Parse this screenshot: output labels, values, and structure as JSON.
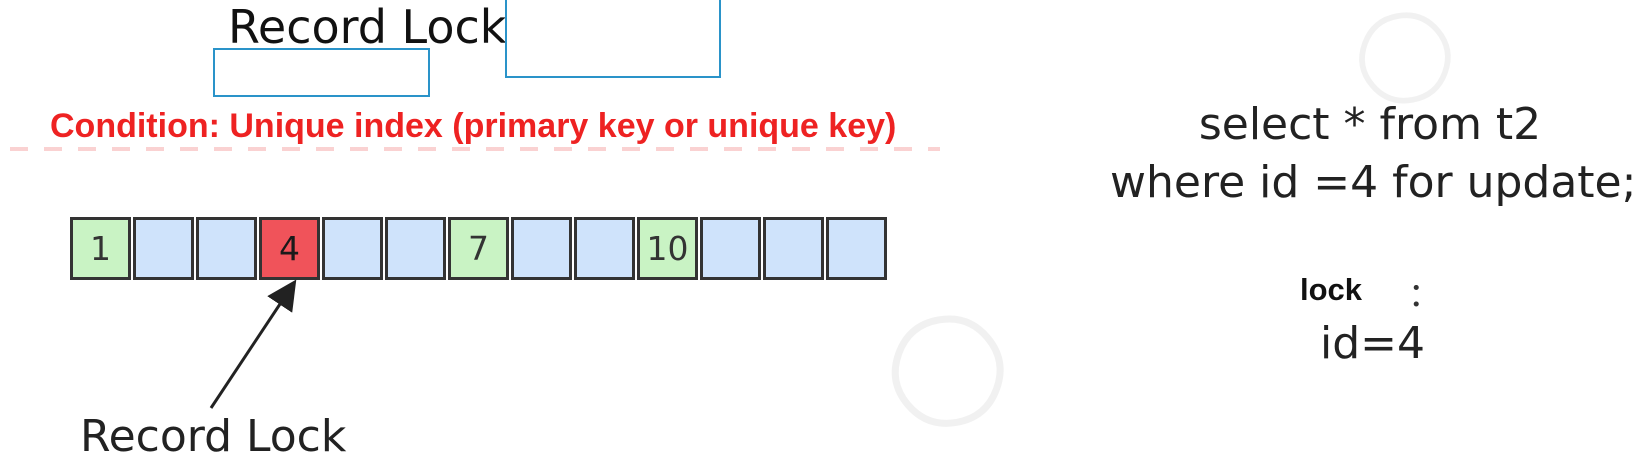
{
  "title": "Record Lock",
  "condition": "Condition: Unique index (primary key or unique key)",
  "cells": [
    {
      "label": "1",
      "state": "green"
    },
    {
      "label": "",
      "state": "blue"
    },
    {
      "label": "",
      "state": "blue"
    },
    {
      "label": "4",
      "state": "red"
    },
    {
      "label": "",
      "state": "blue"
    },
    {
      "label": "",
      "state": "blue"
    },
    {
      "label": "7",
      "state": "green"
    },
    {
      "label": "",
      "state": "blue"
    },
    {
      "label": "",
      "state": "blue"
    },
    {
      "label": "10",
      "state": "green"
    },
    {
      "label": "",
      "state": "blue"
    },
    {
      "label": "",
      "state": "blue"
    },
    {
      "label": "",
      "state": "blue"
    }
  ],
  "arrow_label": "Record Lock",
  "sql": {
    "line1": "select * from t2",
    "line2": "where id =4 for update;"
  },
  "lock": {
    "label": "lock",
    "colon": "：",
    "value": "id=4"
  },
  "colors": {
    "green": "#c9f3c4",
    "blue": "#cfe3fb",
    "red": "#f0535a",
    "condition_text": "#ee2222",
    "box_outline": "#2a93c9"
  }
}
